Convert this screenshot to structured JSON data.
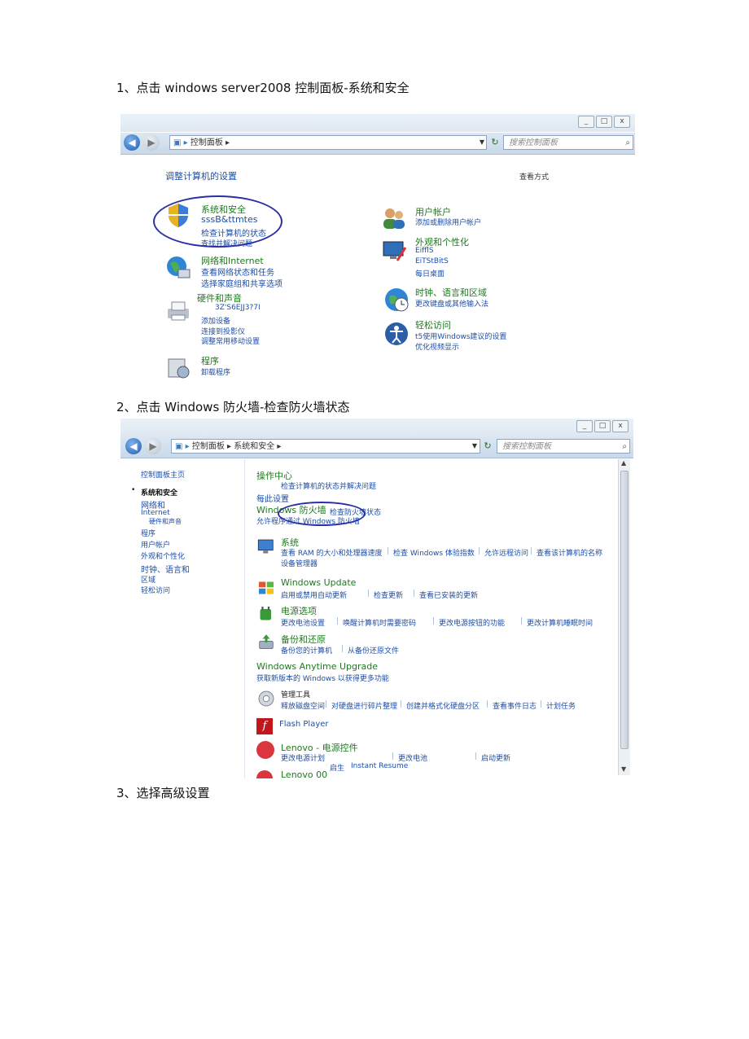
{
  "steps": [
    "1、点击  windows server2008 控制面板-系统和安全",
    "2、点击  Windows 防火墙-检查防火墙状态",
    "3、选择高级设置"
  ],
  "shot1": {
    "window_buttons": [
      "_",
      "□",
      "x"
    ],
    "address": "控制面板",
    "search_placeholder": "搜索控制面板",
    "heading": "调整计算机的设置",
    "view_by": "查看方式",
    "categories": [
      {
        "title": "系统和安全",
        "links": [
          "sssB&ttmtes",
          "检查计算机的状态",
          "查找并解决问题"
        ]
      },
      {
        "title": "网络和Internet",
        "links": [
          "查看网络状态和任务",
          "选择家庭组和共享选项"
        ]
      },
      {
        "title": "硬件和声音",
        "links": [
          "3Z'S6EJJ3?7I",
          "添加设备",
          "连接到投影仪",
          "调整常用移动设置"
        ]
      },
      {
        "title": "程序",
        "links": [
          "卸载程序"
        ]
      },
      {
        "title": "用户帐户",
        "links": [
          "添加或删除用户帐户"
        ]
      },
      {
        "title": "外观和个性化",
        "links": [
          "EifflS",
          "EiTStBitS",
          "每日桌面"
        ]
      },
      {
        "title": "时钟、语言和区域",
        "links": [
          "更改键盘或其他输入法"
        ]
      },
      {
        "title": "轻松访问",
        "links": [
          "t5使用Windows建议的设置",
          "优化视频显示"
        ]
      }
    ]
  },
  "shot2": {
    "window_buttons": [
      "_",
      "□",
      "x"
    ],
    "address": [
      "控制面板",
      "系统和安全"
    ],
    "search_placeholder": "搜索控制面板",
    "sidebar": {
      "home": "控制面板主页",
      "items": [
        "系统和安全",
        "网络和",
        "Internet",
        "硬件和声音",
        "程序",
        "用户帐户",
        "外观和个性化",
        "时钟、语言和",
        "区域",
        "轻松访问"
      ]
    },
    "sections": [
      {
        "title": "操作中心",
        "lines": [
          "检查计算机的状态并解决问题",
          "每此设置"
        ]
      },
      {
        "title": "Windows 防火墙",
        "lines": [
          "检查防火墙状态",
          "允许程序通过 Windows 防火墙"
        ]
      },
      {
        "title": "系统",
        "lines": [
          "查看 RAM 的大小和处理器速度",
          "检查 Windows 体验指数",
          "允许远程访问",
          "查看该计算机的名称",
          "设备管理器"
        ]
      },
      {
        "title": "Windows Update",
        "lines": [
          "启用或禁用自动更新",
          "检查更新",
          "查看已安装的更新"
        ]
      },
      {
        "title": "电源选项",
        "lines": [
          "更改电池设置",
          "唤醒计算机时需要密码",
          "更改电源按钮的功能",
          "更改计算机睡眠时间"
        ]
      },
      {
        "title": "备份和还原",
        "lines": [
          "备份您的计算机",
          "从备份还原文件"
        ]
      },
      {
        "title": "Windows Anytime Upgrade",
        "lines": [
          "获取新版本的 Windows 以获得更多功能"
        ]
      },
      {
        "title": "管理工具",
        "lines": [
          "释放磁盘空间",
          "对硬盘进行碎片整理",
          "创建并格式化硬盘分区",
          "查看事件日志",
          "计划任务"
        ]
      },
      {
        "title": "Flash Player",
        "lines": []
      },
      {
        "title": "Lenovo - 电源控件",
        "lines": [
          "更改电源计划",
          "更改电池",
          "启动更新"
        ]
      },
      {
        "title": "Lenovo 00",
        "lines": [
          "启生",
          "Instant Resume"
        ]
      }
    ]
  },
  "colors": {
    "link": "#1d4ea8",
    "category": "#1e7a1e",
    "annotation": "#2b2fa6"
  }
}
